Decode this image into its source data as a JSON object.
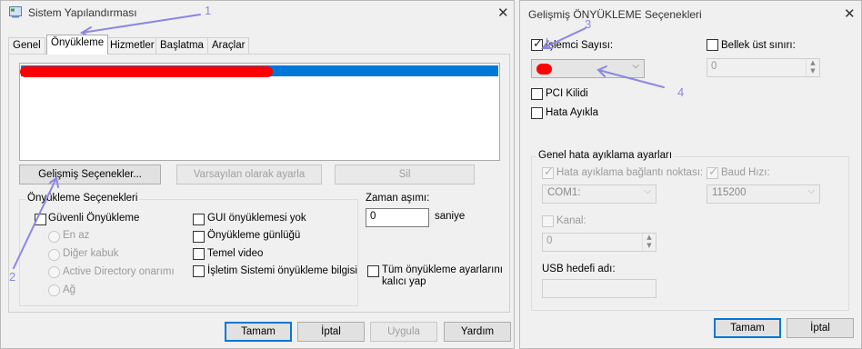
{
  "left": {
    "title": "Sistem Yapılandırması",
    "tabs": [
      "Genel",
      "Önyükleme",
      "Hizmetler",
      "Başlatma",
      "Araçlar"
    ],
    "buttons": {
      "advanced": "Gelişmiş Seçenekler...",
      "set_default": "Varsayılan olarak ayarla",
      "delete": "Sil"
    },
    "boot_options": {
      "legend": "Önyükleme Seçenekleri",
      "safe_boot": "Güvenli Önyükleme",
      "radios": [
        "En az",
        "Diğer kabuk",
        "Active Directory onarımı",
        "Ağ"
      ],
      "checks": [
        "GUI önyüklemesi yok",
        "Önyükleme günlüğü",
        "Temel video",
        "İşletim Sistemi önyükleme bilgisi"
      ]
    },
    "timeout": {
      "label": "Zaman aşımı:",
      "value": "0",
      "unit": "saniye"
    },
    "permanent": "Tüm önyükleme ayarlarını kalıcı yap",
    "footer": [
      "Tamam",
      "İptal",
      "Uygula",
      "Yardım"
    ]
  },
  "right": {
    "title": "Gelişmiş ÖNYÜKLEME Seçenekleri",
    "cpu_count_label": "İşlemci Sayısı:",
    "memory_label": "Bellek üst sınırı:",
    "memory_value": "0",
    "pci_lock": "PCI Kilidi",
    "debug": "Hata Ayıkla",
    "debug_group": {
      "legend": "Genel hata ayıklama ayarları",
      "port_label": "Hata ayıklama bağlantı noktası:",
      "port_value": "COM1:",
      "baud_label": "Baud Hızı:",
      "baud_value": "115200",
      "channel_label": "Kanal:",
      "channel_value": "0",
      "usb_label": "USB hedefi adı:"
    },
    "footer": [
      "Tamam",
      "İptal"
    ]
  },
  "annotations": [
    "1",
    "2",
    "3",
    "4"
  ],
  "colors": {
    "selection": "#0078d7",
    "redaction": "#ff0000",
    "annotation": "#8b87e5"
  }
}
